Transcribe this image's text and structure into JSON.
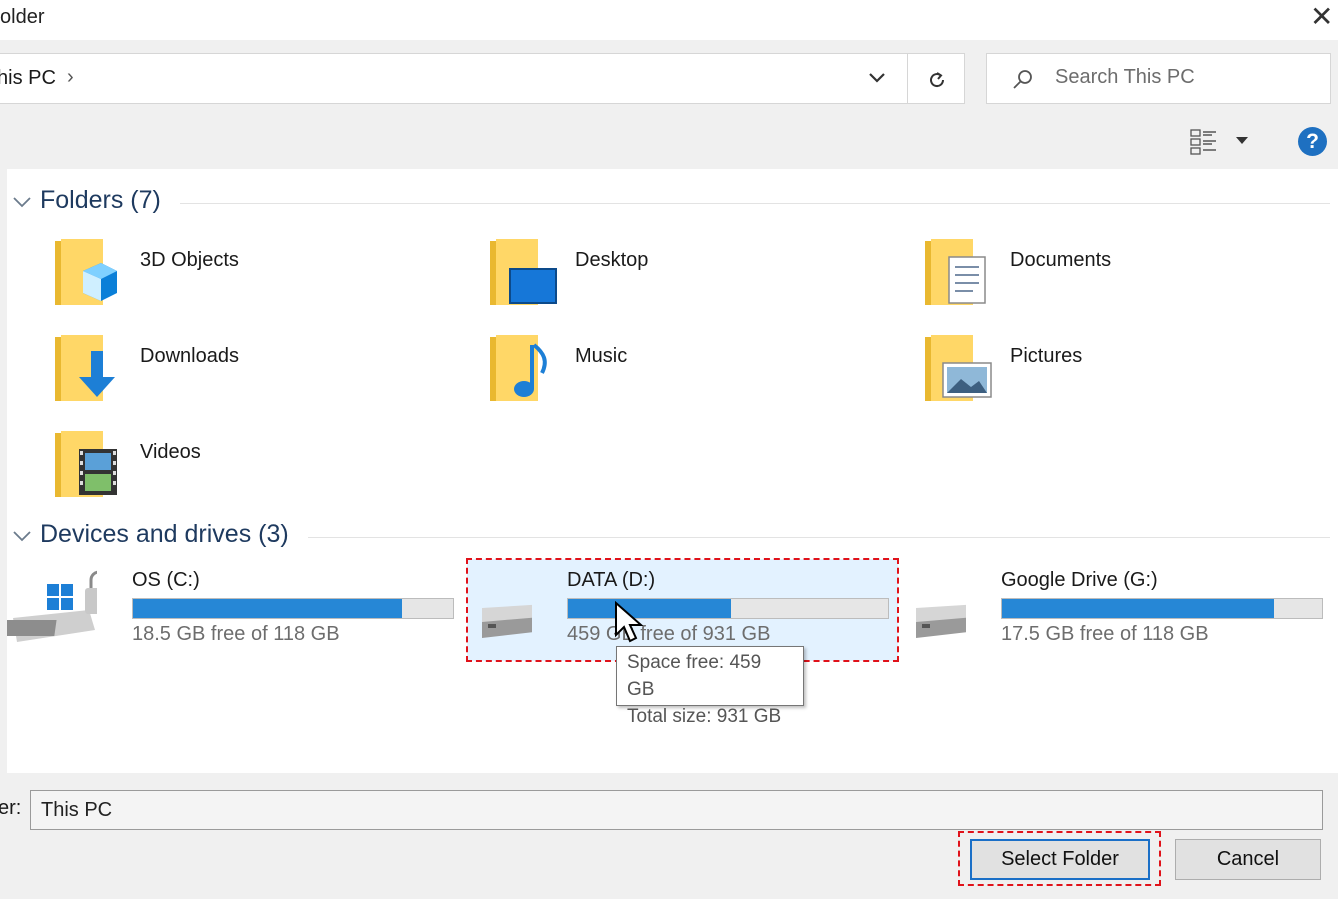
{
  "window": {
    "title": "older",
    "close_icon": "close-icon"
  },
  "address_bar": {
    "path": "his PC",
    "separator": "›"
  },
  "search": {
    "placeholder": "Search This PC"
  },
  "toolbar": {
    "view_icon": "view-options-icon",
    "help": "?"
  },
  "folders_group": {
    "title": "Folders (7)",
    "items": [
      {
        "label": "3D Objects",
        "icon": "3d-objects-folder-icon"
      },
      {
        "label": "Desktop",
        "icon": "desktop-folder-icon"
      },
      {
        "label": "Documents",
        "icon": "documents-folder-icon"
      },
      {
        "label": "Downloads",
        "icon": "downloads-folder-icon"
      },
      {
        "label": "Music",
        "icon": "music-folder-icon"
      },
      {
        "label": "Pictures",
        "icon": "pictures-folder-icon"
      },
      {
        "label": "Videos",
        "icon": "videos-folder-icon"
      }
    ]
  },
  "drives_group": {
    "title": "Devices and drives (3)",
    "items": [
      {
        "name": "OS (C:)",
        "free": "18.5 GB free of 118 GB",
        "used_fraction": 0.84,
        "icon": "windows-drive-icon"
      },
      {
        "name": "DATA (D:)",
        "free": "459 GB free of 931 GB",
        "used_fraction": 0.51,
        "icon": "hard-drive-icon",
        "selected": true
      },
      {
        "name": "Google Drive (G:)",
        "free": "17.5 GB free of 118 GB",
        "used_fraction": 0.85,
        "icon": "hard-drive-icon"
      }
    ]
  },
  "tooltip": {
    "line1": "Space free: 459 GB",
    "line2": "Total size: 931 GB"
  },
  "folder_field": {
    "label": "er:",
    "value": "This PC"
  },
  "buttons": {
    "select": "Select Folder",
    "cancel": "Cancel"
  },
  "colors": {
    "accent": "#2687d6",
    "highlight": "#e0121a",
    "selection": "#cce8ff",
    "help": "#1e70c1"
  }
}
